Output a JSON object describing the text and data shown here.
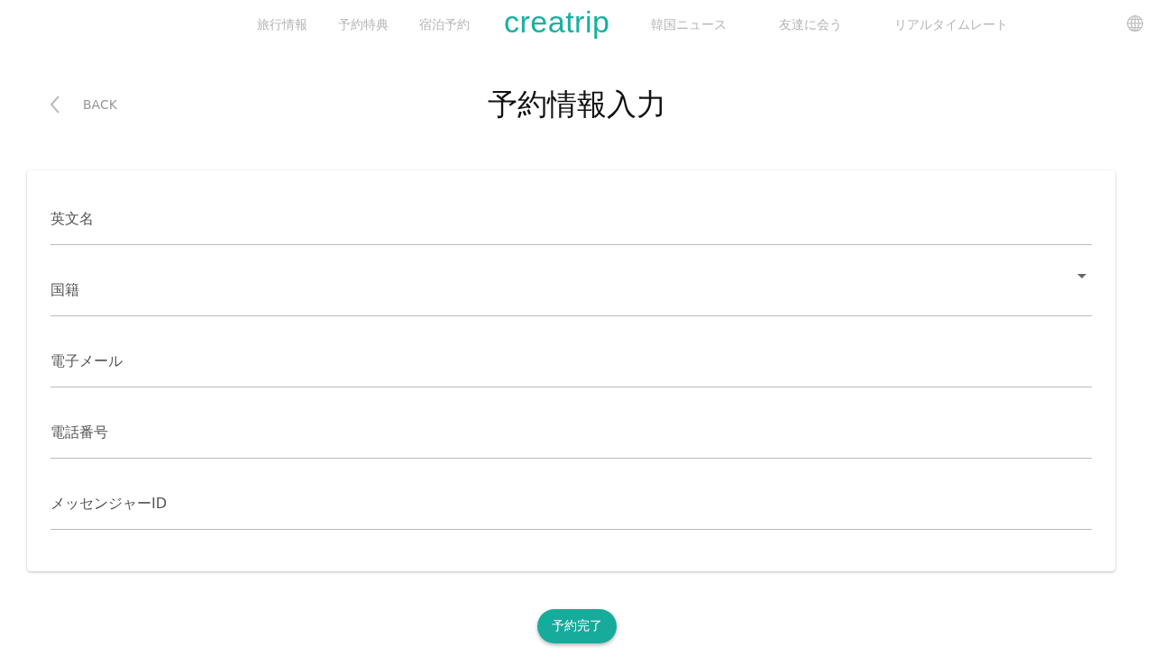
{
  "nav": {
    "left_items": [
      "旅行情報",
      "予約特典",
      "宿泊予約"
    ],
    "logo": "creatrip",
    "right_items": [
      "韓国ニュース",
      "友達に会う",
      "リアルタイムレート"
    ]
  },
  "back": {
    "label": "BACK"
  },
  "title": "予約情報入力",
  "form": {
    "fields": [
      {
        "kind": "text",
        "label": "英文名"
      },
      {
        "kind": "select",
        "label": "国籍"
      },
      {
        "kind": "text",
        "label": "電子メール"
      },
      {
        "kind": "text",
        "label": "電話番号"
      },
      {
        "kind": "text",
        "label": "メッセンジャーID"
      }
    ]
  },
  "submit": {
    "label": "予約完了"
  }
}
